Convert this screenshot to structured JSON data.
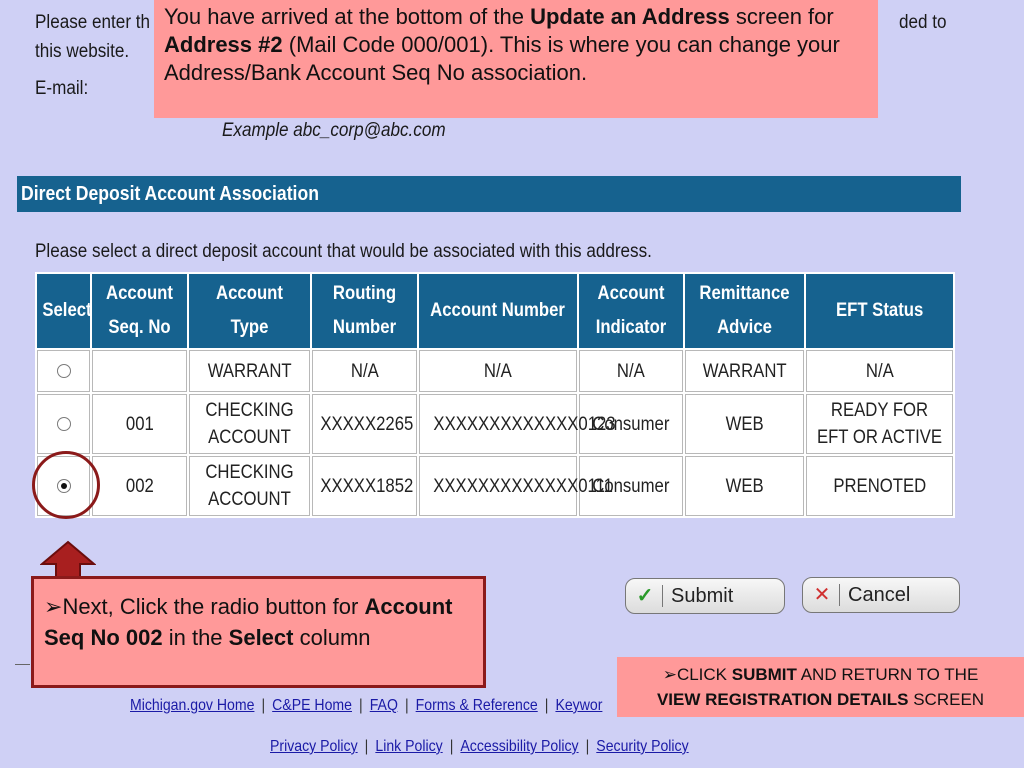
{
  "intro": {
    "line1_start": "Please enter th",
    "line1_end": "ded to",
    "line2": "this website."
  },
  "email": {
    "label": "E-mail:",
    "example": "Example abc_corp@abc.com"
  },
  "section": {
    "title": "Direct Deposit Account Association",
    "prompt": "Please select a direct deposit account that would be associated with this address."
  },
  "table": {
    "headers": [
      "Select",
      "Account Seq. No",
      "Account Type",
      "Routing Number",
      "Account Number",
      "Account Indicator",
      "Remittance Advice",
      "EFT Status"
    ],
    "rows": [
      {
        "selected": false,
        "seq": "",
        "type": "WARRANT",
        "routing": "N/A",
        "account": "N/A",
        "indicator": "N/A",
        "remittance": "WARRANT",
        "status": "N/A"
      },
      {
        "selected": false,
        "seq": "001",
        "type": "CHECKING ACCOUNT",
        "routing": "XXXXX2265",
        "account": "XXXXXXXXXXXXX0123",
        "indicator": "Consumer",
        "remittance": "WEB",
        "status": "READY FOR EFT OR ACTIVE"
      },
      {
        "selected": true,
        "seq": "002",
        "type": "CHECKING ACCOUNT",
        "routing": "XXXXX1852",
        "account": "XXXXXXXXXXXXX0111",
        "indicator": "Consumer",
        "remittance": "WEB",
        "status": "PRENOTED"
      }
    ]
  },
  "buttons": {
    "submit": "Submit",
    "cancel": "Cancel"
  },
  "callouts": {
    "top": {
      "t1": "You have arrived at the bottom of the ",
      "b1": "Update an Address",
      "t2": " screen for ",
      "b2": "Address #2",
      "t3": " (Mail Code 000/001).  This is where you can change your Address/Bank Account Seq No association."
    },
    "left": {
      "bullet": "➢",
      "t1": "Next, Click the radio button for ",
      "b1": "Account Seq No 002",
      "t2": " in the ",
      "b2": "Select",
      "t3": " column"
    },
    "right": {
      "bullet": "➢",
      "t1": "CLICK ",
      "b1": "SUBMIT",
      "t2": " AND RETURN TO THE ",
      "b2": "VIEW REGISTRATION DETAILS",
      "t3": " SCREEN"
    }
  },
  "footer": {
    "row1": [
      "Michigan.gov Home",
      "C&PE Home",
      "FAQ",
      "Forms & Reference",
      "Keywor"
    ],
    "row2": [
      "Privacy Policy",
      "Link Policy",
      "Accessibility Policy",
      "Security Policy"
    ]
  },
  "colors": {
    "background": "#cfd0f5",
    "header": "#16628f",
    "callout": "#ff9999",
    "highlight": "#8b1a1a",
    "link": "#1a1aa6"
  }
}
